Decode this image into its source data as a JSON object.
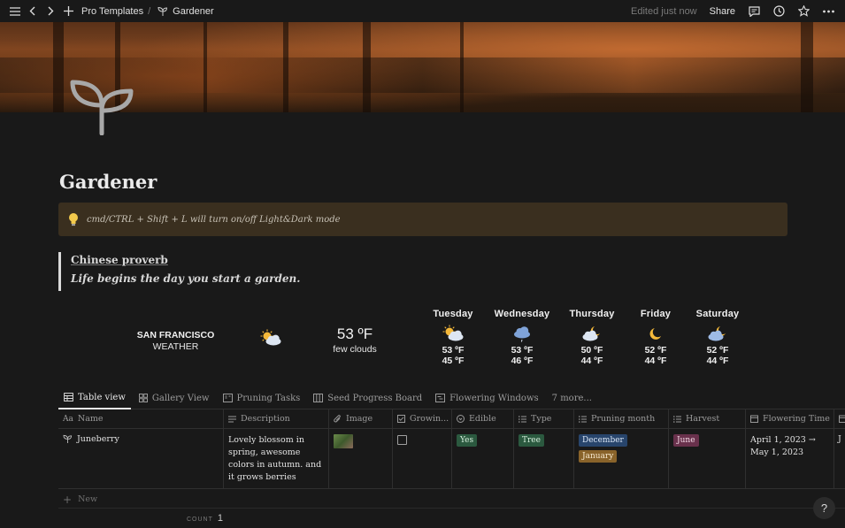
{
  "topbar": {
    "breadcrumb_parent": "Pro Templates",
    "breadcrumb_current": "Gardener",
    "edited": "Edited just now",
    "share": "Share"
  },
  "page": {
    "title": "Gardener",
    "callout": "cmd/CTRL + Shift + L will turn on/off Light&Dark mode",
    "quote_title": "Chinese proverb",
    "quote_text": "Life begins the day you start a garden."
  },
  "weather": {
    "city": "SAN FRANCISCO",
    "label": "WEATHER",
    "current_temp": "53 ºF",
    "current_desc": "few clouds",
    "days": [
      {
        "name": "Tuesday",
        "hi": "53 ºF",
        "lo": "45 ºF",
        "icon": "sun-cloud-icon"
      },
      {
        "name": "Wednesday",
        "hi": "53 ºF",
        "lo": "46 ºF",
        "icon": "rain-cloud-icon"
      },
      {
        "name": "Thursday",
        "hi": "50 ºF",
        "lo": "44 ºF",
        "icon": "moon-cloud-icon"
      },
      {
        "name": "Friday",
        "hi": "52 ºF",
        "lo": "44 ºF",
        "icon": "moon-icon"
      },
      {
        "name": "Saturday",
        "hi": "52 ºF",
        "lo": "44 ºF",
        "icon": "moon-cloud-icon"
      }
    ]
  },
  "tabs": [
    "Table view",
    "Gallery View",
    "Pruning Tasks",
    "Seed Progress Board",
    "Flowering Windows",
    "7 more..."
  ],
  "table": {
    "columns": [
      "Name",
      "Description",
      "Image",
      "Growin...",
      "Edible",
      "Type",
      "Pruning month",
      "Harvest",
      "Flowering Time"
    ],
    "row": {
      "name": "Juneberry",
      "description": "Lovely blossom in spring, awesome colors in autumn. and it grows berries",
      "edible": "Yes",
      "type": "Tree",
      "pruning": [
        "December",
        "January"
      ],
      "harvest": "June",
      "flowering": "April 1, 2023 → May 1, 2023",
      "overflow": "J"
    },
    "new_label": "New",
    "count_label": "COUNT",
    "count_value": "1"
  },
  "help": "?"
}
